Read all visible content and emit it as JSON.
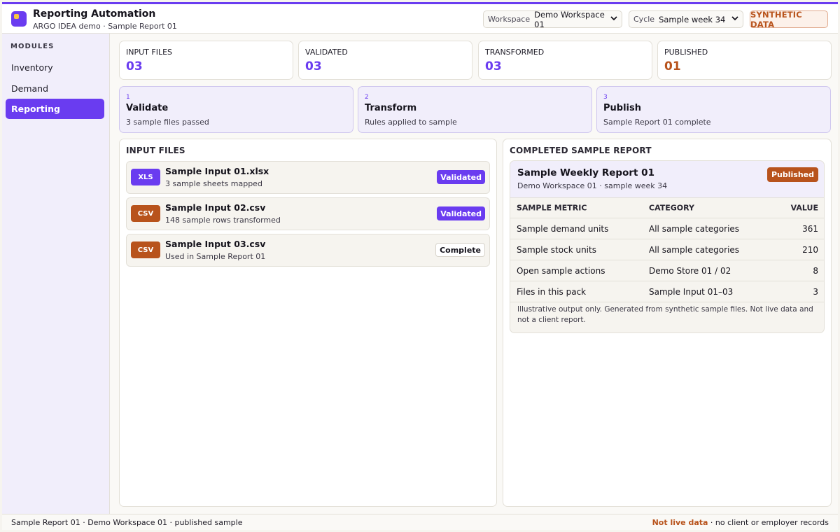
{
  "header": {
    "title": "Reporting Automation",
    "subtitle": "ARGO IDEA demo · Sample Report 01",
    "workspace": {
      "label": "Workspace",
      "value": "Demo Workspace 01"
    },
    "cycle": {
      "label": "Cycle",
      "value": "Sample week 34"
    },
    "badge": "SYNTHETIC DATA"
  },
  "sidebar": {
    "heading": "MODULES",
    "items": [
      {
        "label": "Inventory"
      },
      {
        "label": "Demand"
      },
      {
        "label": "Reporting"
      }
    ],
    "active": "Reporting"
  },
  "stats": [
    {
      "label": "INPUT FILES",
      "value": "03"
    },
    {
      "label": "VALIDATED",
      "value": "03"
    },
    {
      "label": "TRANSFORMED",
      "value": "03"
    },
    {
      "label": "PUBLISHED",
      "value": "01"
    }
  ],
  "steps": [
    {
      "num": "1",
      "title": "Validate",
      "desc": "3 sample files passed"
    },
    {
      "num": "2",
      "title": "Transform",
      "desc": "Rules applied to sample"
    },
    {
      "num": "3",
      "title": "Publish",
      "desc": "Sample Report 01 complete"
    }
  ],
  "input_files": {
    "title": "INPUT FILES",
    "files": [
      {
        "type": "XLS",
        "name": "Sample Input 01.xlsx",
        "desc": "3 sample sheets mapped",
        "status": "Validated"
      },
      {
        "type": "CSV",
        "name": "Sample Input 02.csv",
        "desc": "148 sample rows transformed",
        "status": "Validated"
      },
      {
        "type": "CSV",
        "name": "Sample Input 03.csv",
        "desc": "Used in Sample Report 01",
        "status": "Complete"
      }
    ]
  },
  "report": {
    "panel_title": "COMPLETED SAMPLE REPORT",
    "title": "Sample Weekly Report 01",
    "subtitle": "Demo Workspace 01 · sample week 34",
    "badge": "Published",
    "columns": [
      "SAMPLE METRIC",
      "CATEGORY",
      "VALUE"
    ],
    "rows": [
      {
        "metric": "Sample demand units",
        "category": "All sample categories",
        "value": "361"
      },
      {
        "metric": "Sample stock units",
        "category": "All sample categories",
        "value": "210"
      },
      {
        "metric": "Open sample actions",
        "category": "Demo Store 01 / 02",
        "value": "8"
      },
      {
        "metric": "Files in this pack",
        "category": "Sample Input 01–03",
        "value": "3"
      }
    ],
    "note": "Illustrative output only. Generated from synthetic sample files. Not live data and not a client report."
  },
  "footer": {
    "left": "Sample Report 01 · Demo Workspace 01 · published sample",
    "warning": "Not live data",
    "right": " · no client or employer records"
  },
  "colors": {
    "accent": "#6a3cf0",
    "warning": "#b8531c"
  }
}
